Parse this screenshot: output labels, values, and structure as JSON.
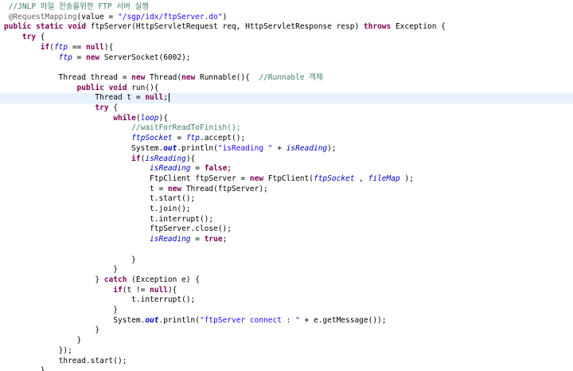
{
  "editor": {
    "current_line_index": 9,
    "caret_after_line_index": 9,
    "colors": {
      "keyword": "#7f0055",
      "field": "#0000c0",
      "string": "#2a00ff",
      "comment": "#3f7f5f",
      "annotation": "#646464",
      "current_line": "#e8f2fe"
    },
    "lines": [
      {
        "indent": 1,
        "tokens": [
          [
            "comment",
            "//JNLP 파일 전송을위한 FTP 서버 실행"
          ]
        ]
      },
      {
        "indent": 1,
        "tokens": [
          [
            "ann",
            "@RequestMapping"
          ],
          [
            "plain",
            "(value = "
          ],
          [
            "string",
            "\"/sgp/idx/ftpServer.do\""
          ],
          [
            "plain",
            ")"
          ]
        ]
      },
      {
        "indent": 0,
        "tokens": [
          [
            "kw",
            "public"
          ],
          [
            "plain",
            " "
          ],
          [
            "kw",
            "static"
          ],
          [
            "plain",
            " "
          ],
          [
            "kw",
            "void"
          ],
          [
            "plain",
            " ftpServer(HttpServletRequest req, HttpServletResponse resp) "
          ],
          [
            "kw",
            "throws"
          ],
          [
            "plain",
            " Exception {"
          ]
        ]
      },
      {
        "indent": 4,
        "tokens": [
          [
            "kw",
            "try"
          ],
          [
            "plain",
            " {"
          ]
        ]
      },
      {
        "indent": 8,
        "tokens": [
          [
            "kw",
            "if"
          ],
          [
            "plain",
            "("
          ],
          [
            "field",
            "ftp"
          ],
          [
            "plain",
            " == "
          ],
          [
            "kw",
            "null"
          ],
          [
            "plain",
            "){"
          ]
        ]
      },
      {
        "indent": 12,
        "tokens": [
          [
            "field",
            "ftp"
          ],
          [
            "plain",
            " = "
          ],
          [
            "kw",
            "new"
          ],
          [
            "plain",
            " ServerSocket(6002);"
          ]
        ]
      },
      {
        "indent": 12,
        "tokens": []
      },
      {
        "indent": 12,
        "tokens": [
          [
            "plain",
            "Thread thread = "
          ],
          [
            "kw",
            "new"
          ],
          [
            "plain",
            " Thread("
          ],
          [
            "kw",
            "new"
          ],
          [
            "plain",
            " Runnable(){  "
          ],
          [
            "comment",
            "//Runnable 객체"
          ]
        ]
      },
      {
        "indent": 16,
        "tokens": [
          [
            "kw",
            "public"
          ],
          [
            "plain",
            " "
          ],
          [
            "kw",
            "void"
          ],
          [
            "plain",
            " run(){"
          ]
        ]
      },
      {
        "indent": 20,
        "tokens": [
          [
            "plain",
            "Thread t = "
          ],
          [
            "kw",
            "null"
          ],
          [
            "plain",
            ";"
          ]
        ]
      },
      {
        "indent": 20,
        "tokens": [
          [
            "kw",
            "try"
          ],
          [
            "plain",
            " {"
          ]
        ]
      },
      {
        "indent": 24,
        "tokens": [
          [
            "kw",
            "while"
          ],
          [
            "plain",
            "("
          ],
          [
            "field",
            "loop"
          ],
          [
            "plain",
            "){"
          ]
        ]
      },
      {
        "indent": 28,
        "tokens": [
          [
            "comment",
            "//waitForReadToFinish();"
          ]
        ]
      },
      {
        "indent": 28,
        "tokens": [
          [
            "field",
            "ftpSocket"
          ],
          [
            "plain",
            " = "
          ],
          [
            "field",
            "ftp"
          ],
          [
            "plain",
            ".accept();"
          ]
        ]
      },
      {
        "indent": 28,
        "tokens": [
          [
            "plain",
            "System."
          ],
          [
            "static",
            "out"
          ],
          [
            "plain",
            ".println("
          ],
          [
            "string",
            "\"isReading \""
          ],
          [
            "plain",
            " + "
          ],
          [
            "field",
            "isReading"
          ],
          [
            "plain",
            ");"
          ]
        ]
      },
      {
        "indent": 28,
        "tokens": [
          [
            "kw",
            "if"
          ],
          [
            "plain",
            "("
          ],
          [
            "field",
            "isReading"
          ],
          [
            "plain",
            "){"
          ]
        ]
      },
      {
        "indent": 32,
        "tokens": [
          [
            "field",
            "isReading"
          ],
          [
            "plain",
            " = "
          ],
          [
            "kw",
            "false"
          ],
          [
            "plain",
            ";"
          ]
        ]
      },
      {
        "indent": 32,
        "tokens": [
          [
            "plain",
            "FtpClient ftpServer = "
          ],
          [
            "kw",
            "new"
          ],
          [
            "plain",
            " FtpClient("
          ],
          [
            "field",
            "ftpSocket"
          ],
          [
            "plain",
            " , "
          ],
          [
            "field",
            "fileMap"
          ],
          [
            "plain",
            " );"
          ]
        ]
      },
      {
        "indent": 32,
        "tokens": [
          [
            "plain",
            "t = "
          ],
          [
            "kw",
            "new"
          ],
          [
            "plain",
            " Thread(ftpServer);"
          ]
        ]
      },
      {
        "indent": 32,
        "tokens": [
          [
            "plain",
            "t.start();"
          ]
        ]
      },
      {
        "indent": 32,
        "tokens": [
          [
            "plain",
            "t.join();"
          ]
        ]
      },
      {
        "indent": 32,
        "tokens": [
          [
            "plain",
            "t.interrupt();"
          ]
        ]
      },
      {
        "indent": 32,
        "tokens": [
          [
            "plain",
            "ftpServer.close();"
          ]
        ]
      },
      {
        "indent": 32,
        "tokens": [
          [
            "field",
            "isReading"
          ],
          [
            "plain",
            " = "
          ],
          [
            "kw",
            "true"
          ],
          [
            "plain",
            ";"
          ]
        ]
      },
      {
        "indent": 32,
        "tokens": []
      },
      {
        "indent": 28,
        "tokens": [
          [
            "plain",
            "}"
          ]
        ]
      },
      {
        "indent": 24,
        "tokens": [
          [
            "plain",
            "}"
          ]
        ]
      },
      {
        "indent": 20,
        "tokens": [
          [
            "plain",
            "} "
          ],
          [
            "kw",
            "catch"
          ],
          [
            "plain",
            " (Exception e) {"
          ]
        ]
      },
      {
        "indent": 24,
        "tokens": [
          [
            "kw",
            "if"
          ],
          [
            "plain",
            "(t != "
          ],
          [
            "kw",
            "null"
          ],
          [
            "plain",
            "){"
          ]
        ]
      },
      {
        "indent": 28,
        "tokens": [
          [
            "plain",
            "t.interrupt();"
          ]
        ]
      },
      {
        "indent": 24,
        "tokens": [
          [
            "plain",
            "}"
          ]
        ]
      },
      {
        "indent": 24,
        "tokens": [
          [
            "plain",
            "System."
          ],
          [
            "static",
            "out"
          ],
          [
            "plain",
            ".println("
          ],
          [
            "string",
            "\"ftpServer connect : \""
          ],
          [
            "plain",
            " + e.getMessage());"
          ]
        ]
      },
      {
        "indent": 20,
        "tokens": [
          [
            "plain",
            "}"
          ]
        ]
      },
      {
        "indent": 16,
        "tokens": [
          [
            "plain",
            "}"
          ]
        ]
      },
      {
        "indent": 12,
        "tokens": [
          [
            "plain",
            "});"
          ]
        ]
      },
      {
        "indent": 12,
        "tokens": [
          [
            "plain",
            "thread.start();"
          ]
        ]
      },
      {
        "indent": 8,
        "tokens": [
          [
            "plain",
            "}"
          ]
        ]
      }
    ]
  }
}
